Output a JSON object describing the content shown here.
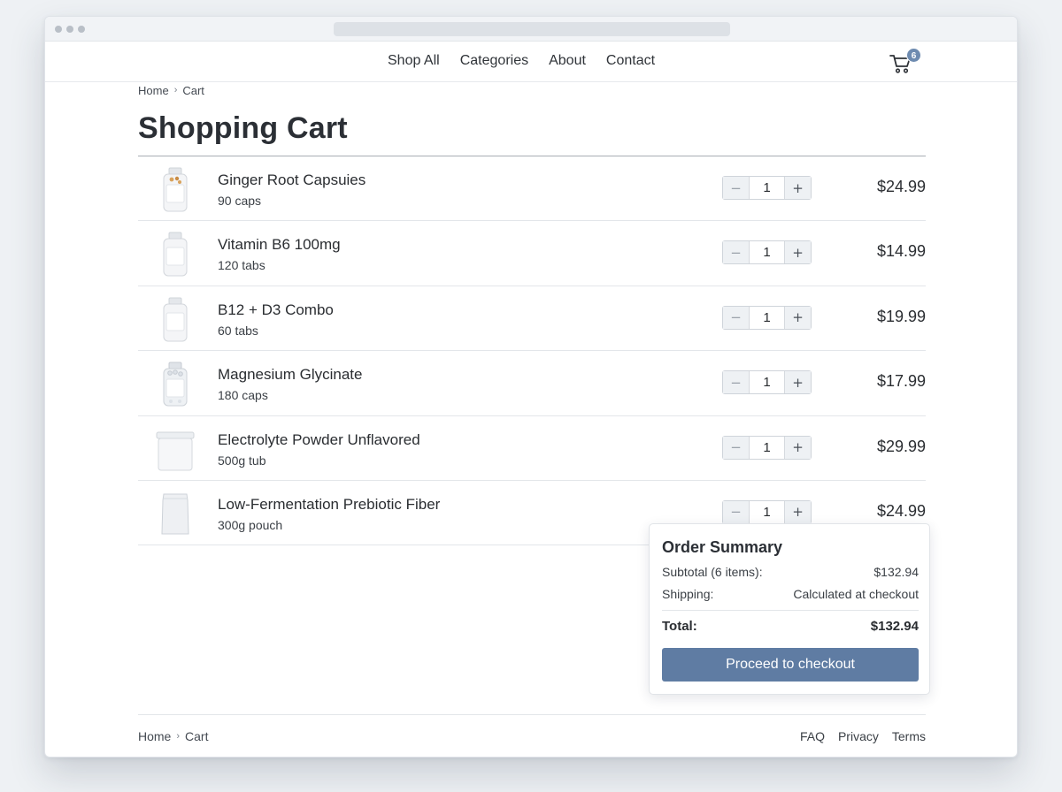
{
  "nav": {
    "links": [
      "Shop All",
      "Categories",
      "About",
      "Contact"
    ],
    "cart_count": "6"
  },
  "breadcrumb": {
    "home": "Home",
    "current": "Cart"
  },
  "page_title": "Shopping Cart",
  "cart_items": [
    {
      "name": "Ginger Root Capsuies",
      "size": "90 caps",
      "quantity": "1",
      "price": "$24.99",
      "thumb": "bottle-amber"
    },
    {
      "name": "Vitamin B6 100mg",
      "size": "120 tabs",
      "quantity": "1",
      "price": "$14.99",
      "thumb": "bottle"
    },
    {
      "name": "B12 + D3 Combo",
      "size": "60 tabs",
      "quantity": "1",
      "price": "$19.99",
      "thumb": "bottle"
    },
    {
      "name": "Magnesium Glycinate",
      "size": "180 caps",
      "quantity": "1",
      "price": "$17.99",
      "thumb": "bottle-clear"
    },
    {
      "name": "Electrolyte Powder Unflavored",
      "size": "500g tub",
      "quantity": "1",
      "price": "$29.99",
      "thumb": "tub"
    },
    {
      "name": "Low-Fermentation Prebiotic Fiber",
      "size": "300g pouch",
      "quantity": "1",
      "price": "$24.99",
      "thumb": "pouch"
    }
  ],
  "qty_controls": {
    "minus": "−",
    "plus": "+"
  },
  "summary": {
    "title": "Order Summary",
    "subtotal_label": "Subtotal (6 items):",
    "subtotal_value": "$132.94",
    "shipping_label": "Shipping:",
    "shipping_value": "Calculated at checkout",
    "total_label": "Total:",
    "total_value": "$132.94",
    "checkout_label": "Proceed to checkout"
  },
  "footer": {
    "breadcrumb_home": "Home",
    "breadcrumb_current": "Cart",
    "links": [
      "FAQ",
      "Privacy",
      "Terms"
    ]
  },
  "colors": {
    "accent": "#5f7ca3",
    "badge": "#6e8bb0",
    "text": "#2a2d31"
  }
}
